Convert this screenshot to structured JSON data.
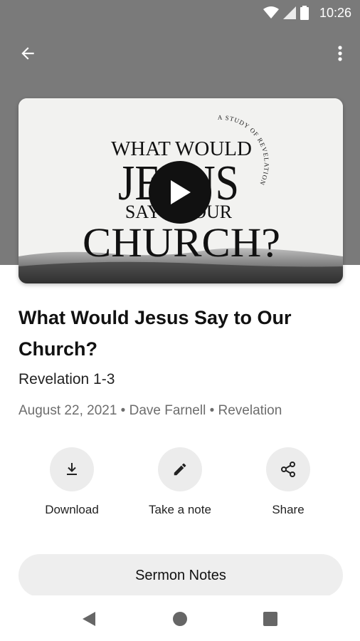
{
  "status_bar": {
    "time": "10:26"
  },
  "app_bar": {
    "back_icon": "arrow-left-icon",
    "menu_icon": "more-vert-icon"
  },
  "artwork": {
    "line1": "WHAT WOULD",
    "line2": "JESUS",
    "line3": "SAY TO OUR",
    "line4": "CHURCH?",
    "curved_text": "A STUDY OF REVELATION 1-3"
  },
  "sermon": {
    "title": "What Would Jesus Say to Our Church?",
    "scripture": "Revelation 1-3",
    "meta": "August 22, 2021 • Dave Farnell • Revelation"
  },
  "actions": {
    "download_label": "Download",
    "note_label": "Take a note",
    "share_label": "Share"
  },
  "notes_button": {
    "label": "Sermon Notes"
  },
  "colors": {
    "header_bg": "#7a7a7a",
    "action_bg": "#ececec",
    "button_bg": "#eeeeee"
  }
}
